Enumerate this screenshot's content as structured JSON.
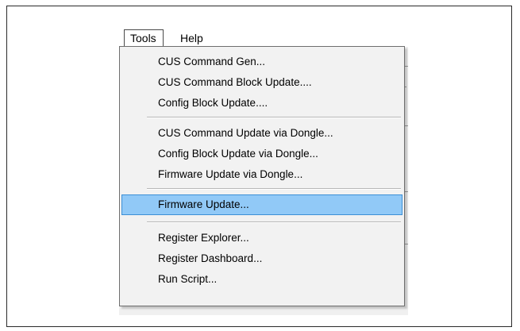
{
  "menubar": {
    "tools_label": "Tools",
    "help_label": "Help"
  },
  "tools_menu": {
    "items": [
      {
        "label": "CUS Command Gen..."
      },
      {
        "label": "CUS Command Block Update...."
      },
      {
        "label": "Config Block Update...."
      },
      {
        "label": "CUS Command Update via Dongle..."
      },
      {
        "label": "Config Block Update via Dongle..."
      },
      {
        "label": "Firmware Update via Dongle..."
      },
      {
        "label": "Firmware Update..."
      },
      {
        "label": "Register Explorer..."
      },
      {
        "label": "Register Dashboard..."
      },
      {
        "label": "Run Script..."
      }
    ],
    "highlighted_item": "Firmware Update...",
    "highlight_color": "#91c9f7",
    "highlight_border_color": "#3c8fd6"
  }
}
